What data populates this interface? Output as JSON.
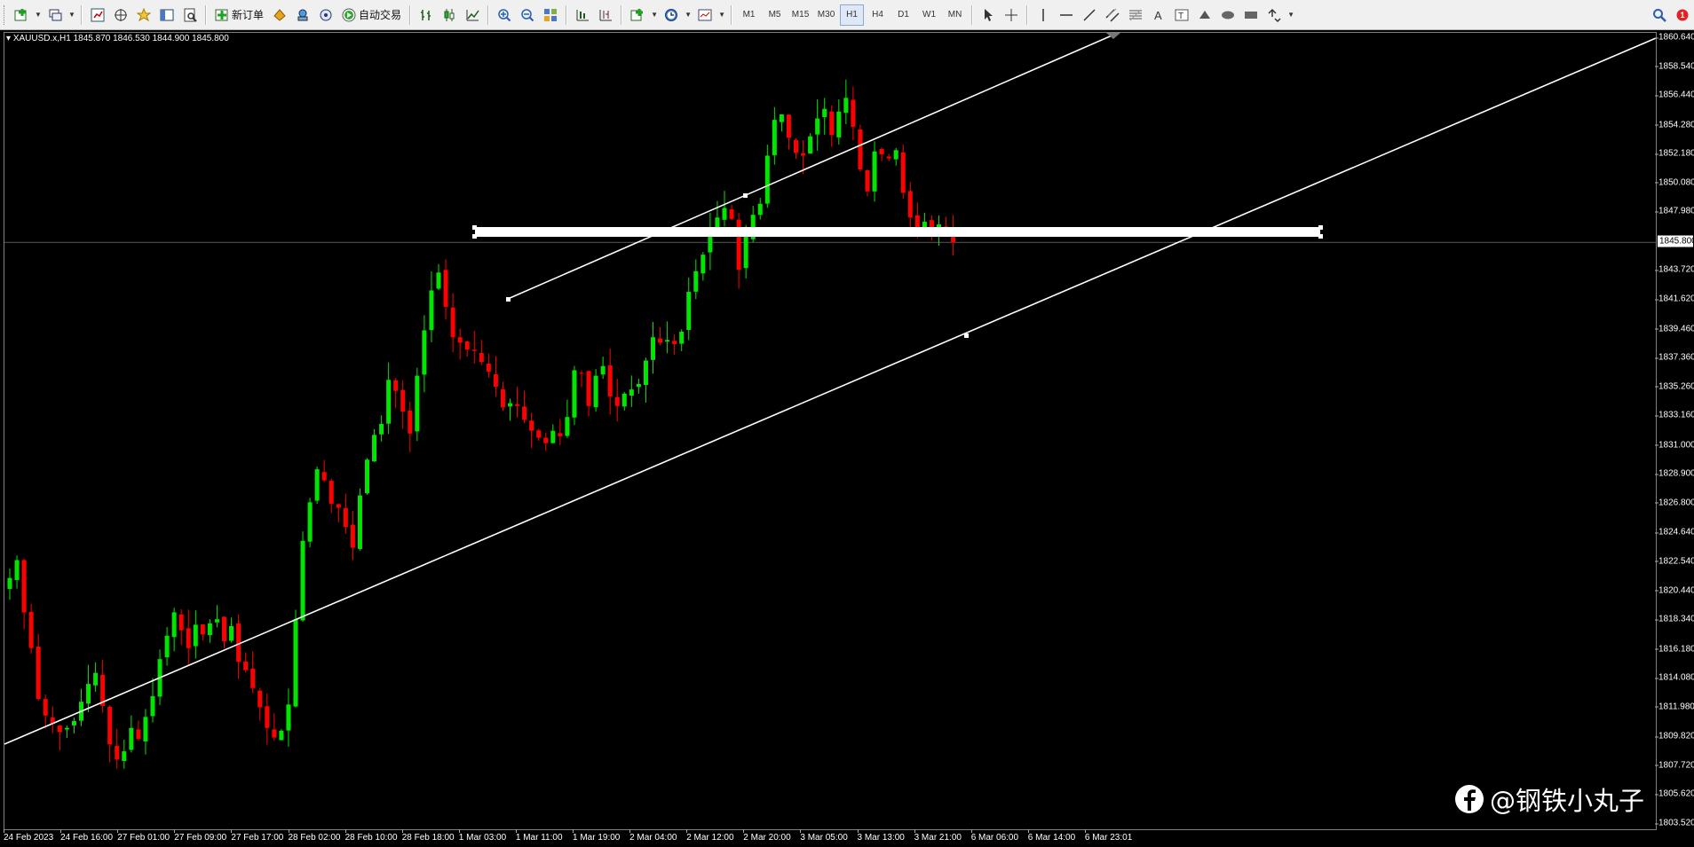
{
  "toolbar": {
    "new_order_label": "新订单",
    "auto_trading_label": "自动交易",
    "timeframes": [
      "M1",
      "M5",
      "M15",
      "M30",
      "H1",
      "H4",
      "D1",
      "W1",
      "MN"
    ],
    "active_timeframe": "H1",
    "notification_count": "1",
    "icons": [
      "new-chart-icon",
      "profiles-icon",
      "market-watch-icon",
      "navigator-icon",
      "favorites-icon",
      "data-window-icon",
      "strategy-tester-icon",
      "new-order-icon",
      "market-icon",
      "signals-icon",
      "auto-trading-icon",
      "bar-chart-icon",
      "candlestick-icon",
      "line-chart-icon",
      "zoom-in-icon",
      "zoom-out-icon",
      "tile-windows-icon",
      "auto-scroll-icon",
      "chart-shift-icon",
      "indicators-icon",
      "periods-icon",
      "templates-icon",
      "cursor-icon",
      "crosshair-icon",
      "vertical-line-icon",
      "horizontal-line-icon",
      "trendline-icon",
      "equidistant-channel-icon",
      "fibonacci-icon",
      "text-icon",
      "text-label-icon",
      "arrows-icon",
      "ellipse-icon",
      "rectangle-icon",
      "shapes-icon",
      "search-icon",
      "notification-icon"
    ]
  },
  "chart": {
    "symbol_info": "XAUUSD.x,H1  1845.870 1846.530 1844.900 1845.800",
    "current_price": "1845.800",
    "price_labels": [
      "1860.640",
      "1858.540",
      "1856.440",
      "1854.280",
      "1852.180",
      "1850.080",
      "1847.980",
      "1843.720",
      "1841.620",
      "1839.460",
      "1837.360",
      "1835.260",
      "1833.160",
      "1831.000",
      "1828.900",
      "1826.800",
      "1824.640",
      "1822.540",
      "1820.440",
      "1818.340",
      "1816.180",
      "1814.080",
      "1811.980",
      "1809.820",
      "1807.720",
      "1805.620",
      "1803.520"
    ],
    "time_labels": [
      "24 Feb 2023",
      "24 Feb 16:00",
      "27 Feb 01:00",
      "27 Feb 09:00",
      "27 Feb 17:00",
      "28 Feb 02:00",
      "28 Feb 10:00",
      "28 Feb 18:00",
      "1 Mar 03:00",
      "1 Mar 11:00",
      "1 Mar 19:00",
      "2 Mar 04:00",
      "2 Mar 12:00",
      "2 Mar 20:00",
      "3 Mar 05:00",
      "3 Mar 13:00",
      "3 Mar 21:00",
      "6 Mar 06:00",
      "6 Mar 14:00",
      "6 Mar 23:01"
    ],
    "colors": {
      "background": "#000000",
      "bull": "#00e600",
      "bear": "#ff0000",
      "objects": "#ffffff"
    }
  },
  "watermark": {
    "text": "@钢铁小丸子",
    "icon": "facebook-logo-icon"
  },
  "chart_data": {
    "type": "candlestick",
    "symbol": "XAUUSD.x",
    "timeframe": "H1",
    "ohlc_last": {
      "open": 1845.87,
      "high": 1846.53,
      "low": 1844.9,
      "close": 1845.8
    },
    "ylim": [
      1803.52,
      1860.64
    ],
    "close_series": [
      1821.4,
      1822.7,
      1818.9,
      1816.3,
      1812.6,
      1811.4,
      1810.8,
      1810.2,
      1810.5,
      1811.0,
      1812.4,
      1813.7,
      1814.5,
      1812.1,
      1809.3,
      1808.2,
      1808.8,
      1810.5,
      1809.7,
      1811.3,
      1812.8,
      1815.5,
      1817.2,
      1818.9,
      1817.6,
      1816.3,
      1818.0,
      1817.3,
      1818.1,
      1818.4,
      1816.8,
      1817.9,
      1815.3,
      1814.7,
      1813.4,
      1812.0,
      1810.5,
      1809.8,
      1810.3,
      1812.2,
      1818.4,
      1824.1,
      1826.9,
      1829.3,
      1828.5,
      1826.8,
      1826.5,
      1825.1,
      1823.6,
      1827.4,
      1830.0,
      1831.8,
      1832.6,
      1835.8,
      1835.0,
      1833.5,
      1831.9,
      1836.1,
      1839.4,
      1842.3,
      1843.6,
      1841.1,
      1838.9,
      1838.5,
      1838.0,
      1837.9,
      1837.1,
      1836.4,
      1835.3,
      1833.8,
      1834.1,
      1833.9,
      1832.9,
      1832.1,
      1831.6,
      1831.2,
      1832.1,
      1831.7,
      1833.1,
      1836.5,
      1836.3,
      1833.9,
      1836.1,
      1836.8,
      1834.6,
      1833.9,
      1834.8,
      1835.1,
      1835.5,
      1837.2,
      1838.9,
      1838.5,
      1838.7,
      1838.4,
      1839.3,
      1842.2,
      1843.7,
      1844.9,
      1846.9,
      1847.6,
      1848.3,
      1847.5,
      1843.8,
      1846.2,
      1847.8,
      1848.6,
      1852.1,
      1854.7,
      1855.1,
      1853.4,
      1852.3,
      1852.1,
      1853.5,
      1854.8,
      1855.5,
      1853.6,
      1855.3,
      1856.3,
      1854.2,
      1851.1,
      1849.5,
      1852.4,
      1852.2,
      1851.9,
      1852.5,
      1849.4,
      1847.6,
      1846.6,
      1847.3,
      1846.8,
      1847.1,
      1846.8,
      1845.8
    ]
  }
}
